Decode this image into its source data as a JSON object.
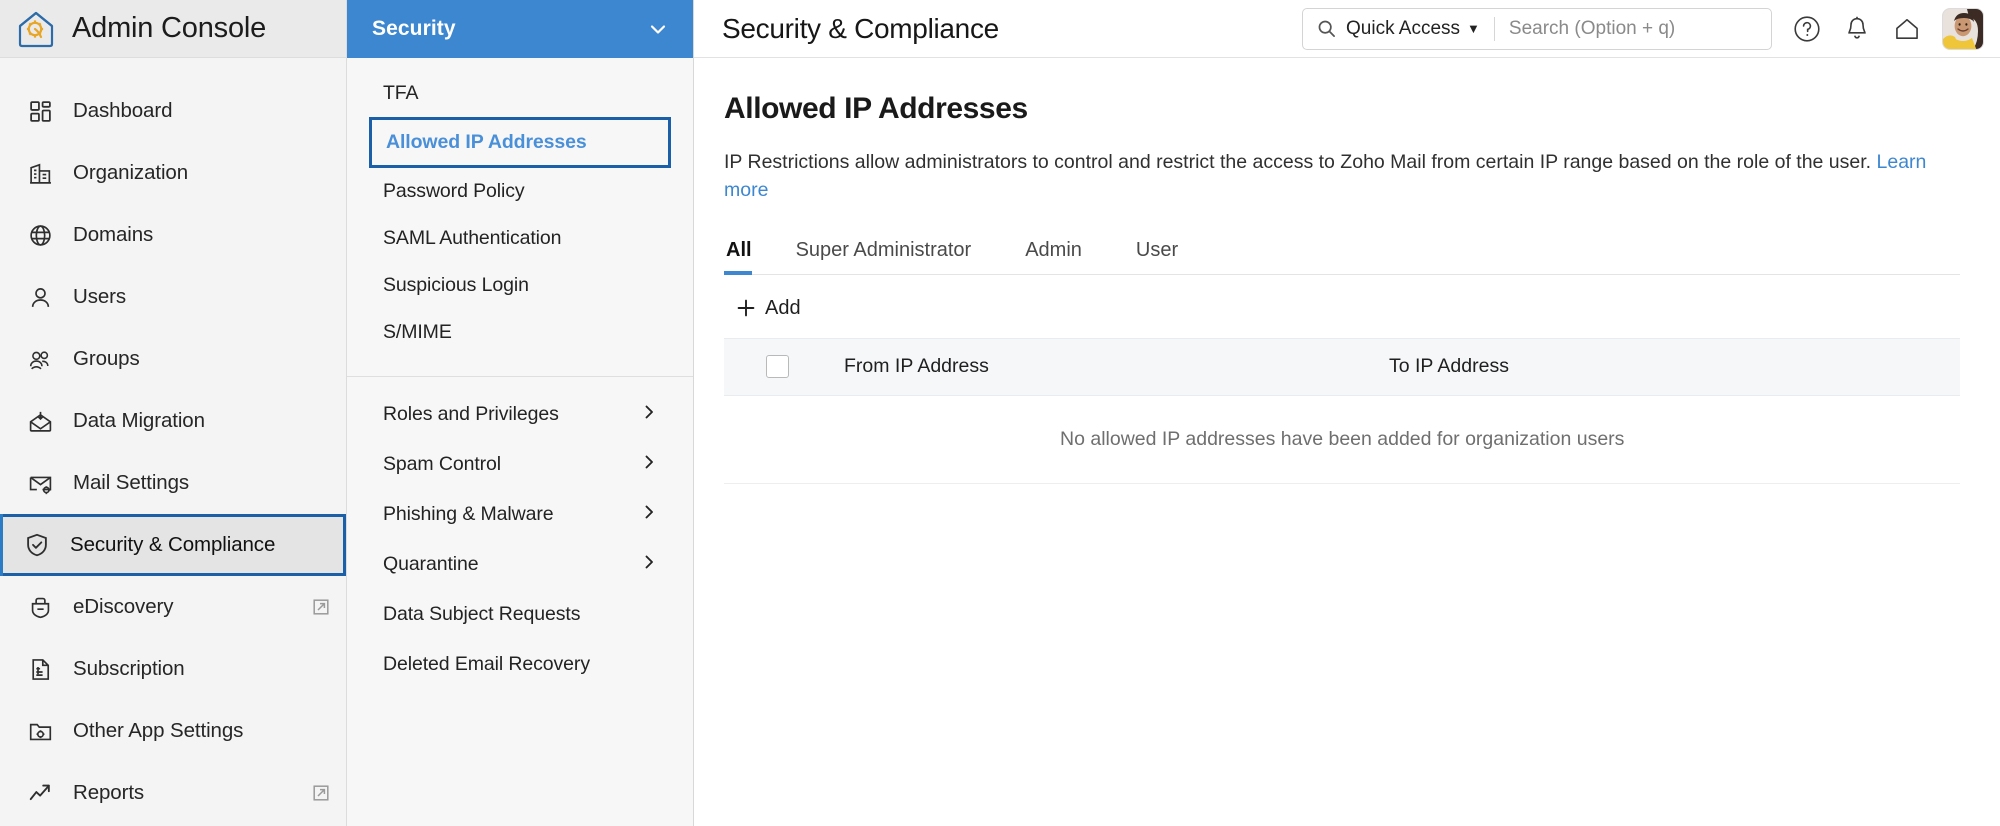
{
  "brand": {
    "title": "Admin Console",
    "logo_icon": "home-gear-icon"
  },
  "sidebar": {
    "items": [
      {
        "label": "Dashboard",
        "icon": "dashboard-grid-icon",
        "selected": false,
        "external": false
      },
      {
        "label": "Organization",
        "icon": "building-icon",
        "selected": false,
        "external": false
      },
      {
        "label": "Domains",
        "icon": "globe-icon",
        "selected": false,
        "external": false
      },
      {
        "label": "Users",
        "icon": "user-icon",
        "selected": false,
        "external": false
      },
      {
        "label": "Groups",
        "icon": "group-users-icon",
        "selected": false,
        "external": false
      },
      {
        "label": "Data Migration",
        "icon": "envelope-download-icon",
        "selected": false,
        "external": false
      },
      {
        "label": "Mail Settings",
        "icon": "envelope-gear-icon",
        "selected": false,
        "external": false
      },
      {
        "label": "Security & Compliance",
        "icon": "shield-check-icon",
        "selected": true,
        "external": false
      },
      {
        "label": "eDiscovery",
        "icon": "briefcase-search-icon",
        "selected": false,
        "external": true
      },
      {
        "label": "Subscription",
        "icon": "invoice-icon",
        "selected": false,
        "external": false
      },
      {
        "label": "Other App Settings",
        "icon": "folder-gear-icon",
        "selected": false,
        "external": false
      },
      {
        "label": "Reports",
        "icon": "trend-arrow-icon",
        "selected": false,
        "external": true
      }
    ]
  },
  "subnav": {
    "header": {
      "title": "Security",
      "chevron_icon": "chevron-down-icon"
    },
    "items": [
      {
        "label": "TFA",
        "active": false,
        "chevron": false
      },
      {
        "label": "Allowed IP Addresses",
        "active": true,
        "chevron": false
      },
      {
        "label": "Password Policy",
        "active": false,
        "chevron": false
      },
      {
        "label": "SAML Authentication",
        "active": false,
        "chevron": false
      },
      {
        "label": "Suspicious Login",
        "active": false,
        "chevron": false
      },
      {
        "label": "S/MIME",
        "active": false,
        "chevron": false
      }
    ],
    "groups": [
      {
        "label": "Roles and Privileges",
        "chevron": true
      },
      {
        "label": "Spam Control",
        "chevron": true
      },
      {
        "label": "Phishing & Malware",
        "chevron": true
      },
      {
        "label": "Quarantine",
        "chevron": true
      },
      {
        "label": "Data Subject Requests",
        "chevron": false
      },
      {
        "label": "Deleted Email Recovery",
        "chevron": false
      }
    ]
  },
  "header": {
    "page_title": "Security & Compliance",
    "quick_access_label": "Quick Access",
    "quick_access_caret": "▼",
    "search_placeholder": "Search (Option + q)",
    "search_value": "",
    "search_icon": "search-icon",
    "icons": [
      {
        "name": "help-icon"
      },
      {
        "name": "bell-icon"
      },
      {
        "name": "home-icon"
      }
    ],
    "avatar_name": "user-avatar"
  },
  "content": {
    "title": "Allowed IP Addresses",
    "description": "IP Restrictions allow administrators to control and restrict the access to Zoho Mail from certain IP range based on the role of the user.",
    "learn_more": "Learn more",
    "tabs": [
      {
        "label": "All",
        "active": true
      },
      {
        "label": "Super Administrator",
        "active": false
      },
      {
        "label": "Admin",
        "active": false
      },
      {
        "label": "User",
        "active": false
      }
    ],
    "add_label": "Add",
    "add_icon": "plus-icon",
    "table": {
      "columns": [
        "From IP Address",
        "To IP Address"
      ],
      "rows": [],
      "empty_message": "No allowed IP addresses have been added for organization users",
      "select_all_checkbox": false
    }
  },
  "colors": {
    "accent_blue": "#3d87d0",
    "focus_blue": "#1a5fa8",
    "sidebar_bg": "#f4f4f4",
    "subnav_bg": "#f7f7f7",
    "table_header_bg": "#f5f7f9"
  }
}
